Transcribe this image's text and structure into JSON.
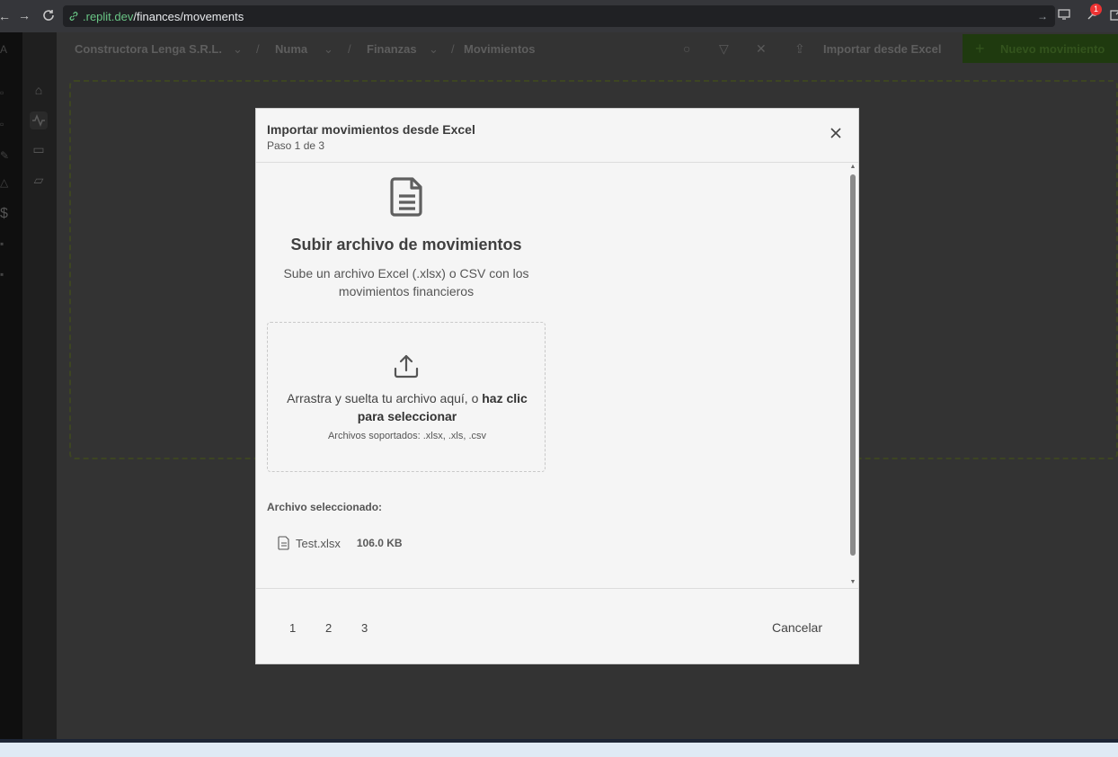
{
  "browser": {
    "url_host": ".replit.dev",
    "url_path": "/finances/movements",
    "notification_count": "1"
  },
  "breadcrumb": {
    "company": "Constructora Lenga S.R.L.",
    "project": "Numa",
    "section": "Finanzas",
    "page": "Movimientos"
  },
  "toolbar": {
    "import_label": "Importar desde Excel",
    "new_label": "Nuevo movimiento"
  },
  "modal": {
    "title": "Importar movimientos desde Excel",
    "subtitle": "Paso 1 de 3",
    "upload_title": "Subir archivo de movimientos",
    "upload_desc": "Sube un archivo Excel (.xlsx) o CSV con los movimientos financieros",
    "drop_text_plain": "Arrastra y suelta tu archivo aquí, o ",
    "drop_text_bold": "haz clic para seleccionar",
    "drop_hint": "Archivos soportados: .xlsx, .xls, .csv",
    "selected_label": "Archivo seleccionado:",
    "file_name": "Test.xlsx",
    "file_size": "106.0 KB",
    "steps": [
      "1",
      "2",
      "3"
    ],
    "cancel_label": "Cancelar"
  }
}
